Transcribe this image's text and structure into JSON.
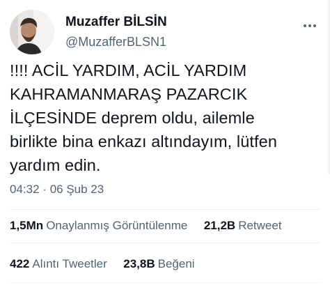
{
  "author": {
    "display_name": "Muzaffer BİLSİN",
    "handle": "@MuzafferBLSN1"
  },
  "tweet": {
    "text": "!!!! ACİL YARDIM, ACİL YARDIM\nKAHRAMANMARAŞ PAZARCIK\nİLÇESİNDE deprem oldu, ailemle\nbirlikte bina enkazı altındayım, lütfen\nyardım edin.",
    "time": "04:32",
    "separator": "·",
    "date": "06 Şub 23"
  },
  "stats": {
    "views_count": "1,5Mn",
    "views_label": "Onaylanmış Görüntülenme",
    "retweets_count": "21,2B",
    "retweets_label": "Retweet",
    "quotes_count": "422",
    "quotes_label": "Alıntı Tweetler",
    "likes_count": "23,8B",
    "likes_label": "Beğeni"
  },
  "icons": {
    "more": "more-options-icon"
  },
  "colors": {
    "text": "#0f1419",
    "secondary": "#536471",
    "divider": "#eff3f4"
  }
}
